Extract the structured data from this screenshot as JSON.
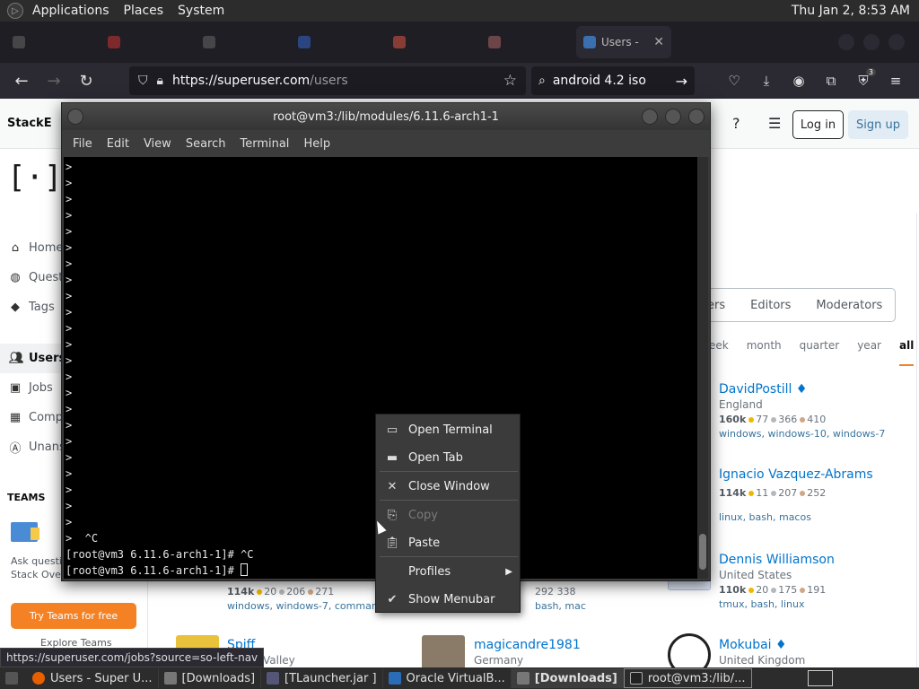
{
  "top_panel": {
    "menus": [
      "Applications",
      "Places",
      "System"
    ],
    "clock": "Thu Jan  2,  8:53 AM"
  },
  "firefox": {
    "active_tab_title": "Users -",
    "url_host": "https://superuser.com",
    "url_path": "/users",
    "search_text": "android 4.2 iso",
    "addon_badge": "3"
  },
  "site": {
    "brand": "StackE",
    "logo": "[·] su",
    "login": "Log in",
    "signup": "Sign up",
    "nav": [
      "Home",
      "Questi",
      "Tags",
      "Users",
      "Jobs",
      "Comp",
      "Unans"
    ],
    "teams_label": "TEAMS",
    "teams_text": "Ask questio and collabo Stack Overflow for Teams.",
    "try_teams": "Try Teams for free",
    "explore_teams": "Explore Teams",
    "filter_tabs": [
      "oters",
      "Editors",
      "Moderators"
    ],
    "time_tabs": [
      "eek",
      "month",
      "quarter",
      "year",
      "all"
    ],
    "users": [
      {
        "name": "DavidPostill ♦",
        "location": "England",
        "rep": "160k",
        "gold": "77",
        "silver": "366",
        "bronze": "410",
        "tags": "windows, windows-10, windows-7"
      },
      {
        "name": "Ignacio Vazquez-Abrams",
        "location": "",
        "rep": "114k",
        "gold": "11",
        "silver": "207",
        "bronze": "252",
        "tags": "linux, bash, macos"
      },
      {
        "name": "Dennis Williamson",
        "location": "United States",
        "rep": "110k",
        "gold": "20",
        "silver": "175",
        "bronze": "191",
        "tags": "tmux, bash, linux"
      },
      {
        "name": "Mokubai ♦",
        "location": "United Kingdom",
        "rep": "",
        "gold": "",
        "silver": "",
        "bronze": "",
        "tags": ""
      }
    ],
    "middle_user": {
      "name": "magicandre1981",
      "location": "Germany",
      "stats": "292  338",
      "tags": "bash, mac"
    },
    "left_user": {
      "name": "Spiff",
      "location": "Valley",
      "rep": "114k",
      "gold": "20",
      "silver": "206",
      "bronze": "271",
      "tags": "windows, windows-7, comman"
    }
  },
  "terminal": {
    "title": "root@vm3:/lib/modules/6.11.6-arch1-1",
    "menus": [
      "File",
      "Edit",
      "View",
      "Search",
      "Terminal",
      "Help"
    ],
    "prompt_lines": [
      ">",
      ">",
      ">",
      ">",
      ">",
      ">",
      ">",
      ">",
      ">",
      ">",
      ">",
      ">",
      ">",
      ">",
      ">",
      ">",
      ">",
      ">",
      ">",
      ">",
      ">",
      ">",
      ">"
    ],
    "ctrl_c_line": ">  ^C",
    "prompt1": "[root@vm3 6.11.6-arch1-1]# ^C",
    "prompt2": "[root@vm3 6.11.6-arch1-1]# "
  },
  "context_menu": {
    "open_terminal": "Open Terminal",
    "open_tab": "Open Tab",
    "close_window": "Close Window",
    "copy": "Copy",
    "paste": "Paste",
    "profiles": "Profiles",
    "show_menubar": "Show Menubar"
  },
  "status_url": "https://superuser.com/jobs?source=so-left-nav",
  "taskbar": {
    "tasks": [
      "Users - Super U...",
      "[Downloads]",
      "[TLauncher.jar ]",
      "Oracle VirtualB...",
      "[Downloads]",
      "root@vm3:/lib/..."
    ]
  }
}
